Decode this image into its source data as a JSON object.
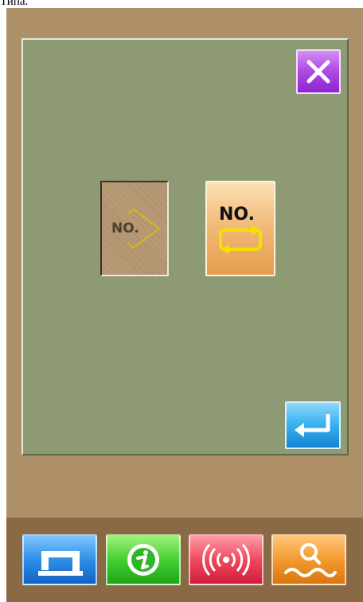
{
  "caption": "Типа.",
  "panel": {
    "no_select_label": "NO.",
    "no_cycle_label": "NO."
  },
  "icons": {
    "close": "close-x-icon",
    "no_select": "diamond-arrow-icon",
    "no_cycle": "loop-arrows-icon",
    "enter": "return-arrow-icon",
    "sewing": "sewing-machine-icon",
    "info": "info-i-icon",
    "comm": "wireless-signal-icon",
    "search": "magnifier-wave-icon"
  },
  "colors": {
    "background": "#ae9068",
    "panel": "#8d9a73",
    "close_button": "#b04ee6",
    "enter_button": "#3db3ef",
    "nav_sewing": "#2e8fe6",
    "nav_info": "#45cf32",
    "nav_comm": "#ee4a5f",
    "nav_search": "#f39a2f"
  }
}
